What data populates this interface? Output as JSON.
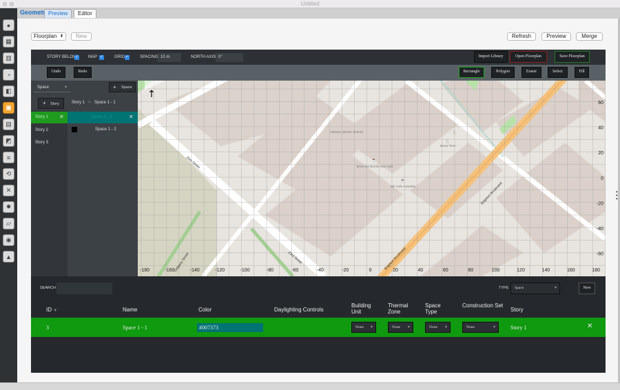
{
  "window": {
    "title": "Untitled"
  },
  "tabs": {
    "app_label": "Geometry",
    "preview": "Preview",
    "editor": "Editor"
  },
  "toolbar": {
    "mode_select": "Floorplan",
    "new_label": "New",
    "refresh": "Refresh",
    "preview": "Preview",
    "merge": "Merge"
  },
  "editor_top": {
    "story_below": "STORY BELOW",
    "map": "MAP",
    "grid": "GRID",
    "spacing_label": "SPACING",
    "spacing_value": "10 m",
    "north_axis_label": "NORTH AXIS",
    "north_axis_value": "0°",
    "import_library": "Import Library",
    "open_floorplan": "Open Floorplan",
    "save_floorplan": "Save Floorplan"
  },
  "tools": {
    "undo": "Undo",
    "redo": "Redo",
    "rectangle": "Rectangle",
    "polygon": "Polygon",
    "eraser": "Eraser",
    "select": "Select",
    "fill": "Fill"
  },
  "left_panel": {
    "type_select": "Space",
    "add_space": "Space",
    "add_story": "Story",
    "breadcrumb_story": "Story 1",
    "breadcrumb_sep": ">",
    "breadcrumb_space": "Space 1 - 1",
    "stories": [
      "Story 1",
      "Story 2",
      "Story 3"
    ],
    "spaces": [
      {
        "name": "Space 1 - 1",
        "color": "#007373"
      },
      {
        "name": "Space 1 - 2",
        "color": "#000000"
      }
    ]
  },
  "map": {
    "x_ticks": [
      "-180",
      "-160",
      "-140",
      "-120",
      "-100",
      "-80",
      "-60",
      "-40",
      "-20",
      "0",
      "20",
      "40",
      "60",
      "80",
      "100",
      "120",
      "140",
      "160",
      "180"
    ],
    "y_ticks": [
      "60",
      "40",
      "20",
      "0",
      "-20",
      "-40",
      "-60"
    ],
    "streets": [
      "25th Street",
      "23rd Street",
      "Brighton Boulevard",
      "Brighton Boulevard",
      "Delgany Street"
    ],
    "pois": [
      "Industry Denver Shared",
      "Welcome Burrito Hoe Cafe",
      "Wit Cafe Coworks",
      "Meow Tone"
    ]
  },
  "search": {
    "label": "SEARCH",
    "type_label": "TYPE",
    "type_value": "Space",
    "new_label": "New"
  },
  "table": {
    "headers": {
      "id": "ID",
      "name": "Name",
      "color": "Color",
      "daylighting": "Daylighting Controls",
      "building_unit": "Building Unit",
      "thermal_zone": "Thermal Zone",
      "space_type": "Space Type",
      "construction_set": "Construction Set",
      "story": "Story"
    },
    "rows": [
      {
        "id": "3",
        "name": "Space 1 - 1",
        "color": "#007373",
        "building_unit": "None",
        "thermal_zone": "None",
        "space_type": "None",
        "construction_set": "None",
        "story": "Story 1",
        "delete": "✕"
      }
    ]
  },
  "icons": [
    "sphere-icon",
    "table-icon",
    "building-icon",
    "gauge-icon",
    "cube-icon",
    "floorplan-icon",
    "facade-icon",
    "box-icon",
    "layers-icon",
    "loop-icon",
    "tools-icon",
    "gear-icon",
    "site-icon",
    "globe-icon",
    "chart-icon"
  ]
}
